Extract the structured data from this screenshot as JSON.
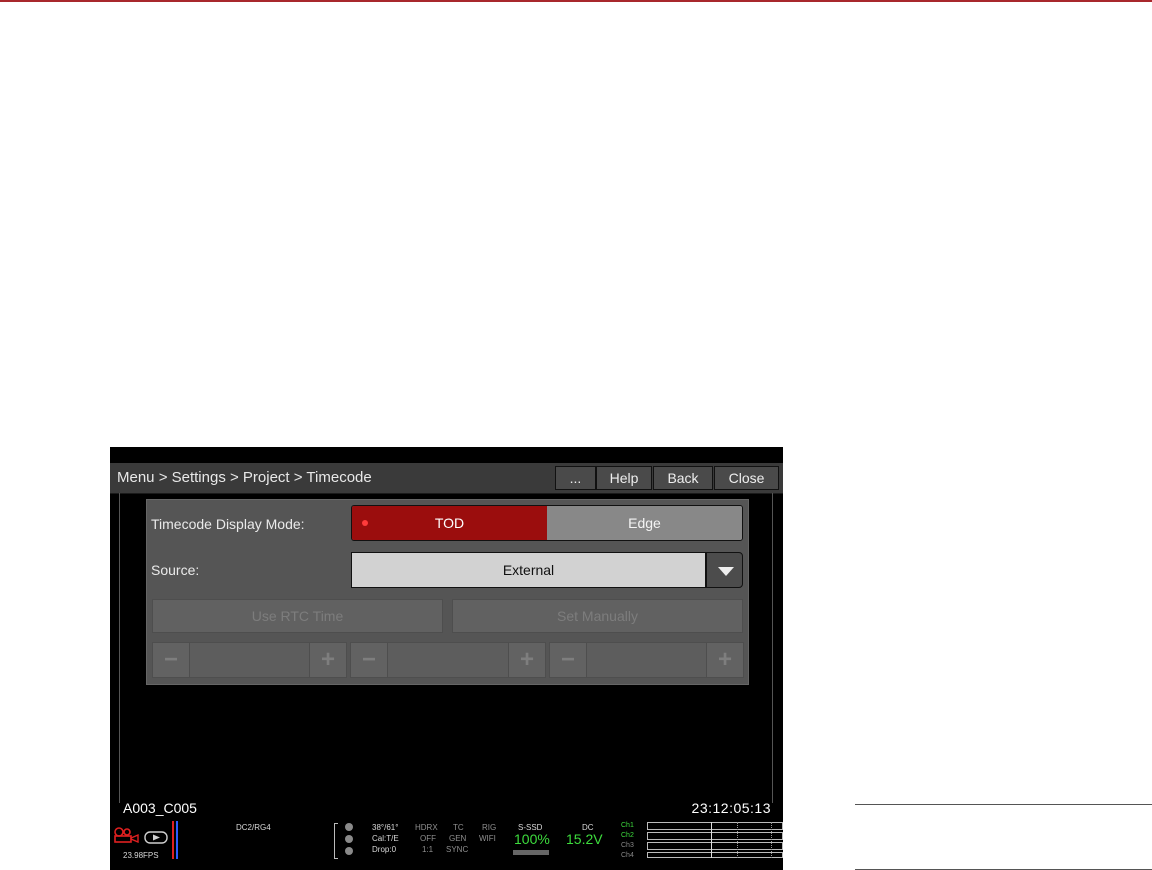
{
  "header": {
    "breadcrumb": "Menu > Settings > Project > Timecode",
    "buttons": {
      "more": "...",
      "help": "Help",
      "back": "Back",
      "close": "Close"
    }
  },
  "timecode_display_mode": {
    "label": "Timecode Display Mode:",
    "options": [
      "TOD",
      "Edge"
    ],
    "selected": "TOD"
  },
  "source": {
    "label": "Source:",
    "value": "External"
  },
  "actions": {
    "use_rtc": "Use RTC Time",
    "set_manually": "Set Manually"
  },
  "clip": {
    "name": "A003_C005",
    "timecode": "23:12:05:13"
  },
  "status": {
    "fps": "23.98FPS",
    "codec": "DC2/RG4",
    "temp": "38°/61°",
    "cal": "Cal:T/E",
    "drop": "Drop:0",
    "hdrx_label": "HDRX",
    "hdrx_value": "OFF",
    "ratio": "1:1",
    "tc_label": "TC",
    "tc_value": "GEN",
    "sync": "SYNC",
    "rig_label": "RIG",
    "rig_value": "WIFI",
    "media_label": "S-SSD",
    "media_value": "100%",
    "power_label": "DC",
    "power_value": "15.2V",
    "channels": [
      "Ch1",
      "Ch2",
      "Ch3",
      "Ch4"
    ],
    "colors": {
      "accent_red": "#9b0d0d",
      "green": "#3ddc3d",
      "record_red": "#e02020"
    }
  }
}
